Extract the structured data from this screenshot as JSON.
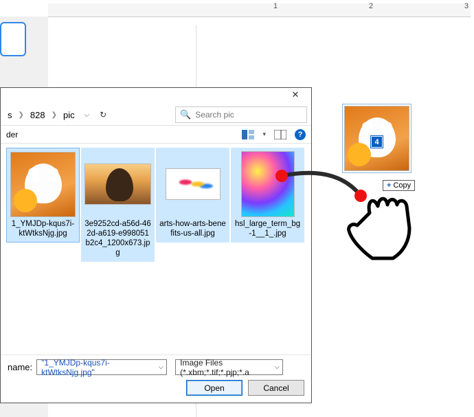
{
  "ruler": {
    "t1": "1",
    "t2": "2",
    "t3": "3"
  },
  "dialog": {
    "breadcrumb": {
      "seg1": "s",
      "seg2": "828",
      "seg3": "pic"
    },
    "search_placeholder": "Search pic",
    "subbar_label": "der",
    "files": [
      {
        "name": "1_YMJDp-kqus7i-ktWtksNjg.jpg"
      },
      {
        "name": "3e9252cd-a56d-462d-a619-e998051b2c4_1200x673.jpg"
      },
      {
        "name": "arts-how-arts-benefits-us-all.jpg"
      },
      {
        "name": "hsl_large_term_bg-1__1_.jpg"
      }
    ],
    "filename_label": "name:",
    "filename_value": "\"1_YMJDp-kqus7i-ktWtksNjg.jpg\"",
    "filetype_value": "Image Files (*.xbm;*.tif;*.pjp;*.a",
    "open_label": "Open",
    "cancel_label": "Cancel"
  },
  "drop": {
    "page_indicator": "4",
    "copy_label": "Copy"
  }
}
